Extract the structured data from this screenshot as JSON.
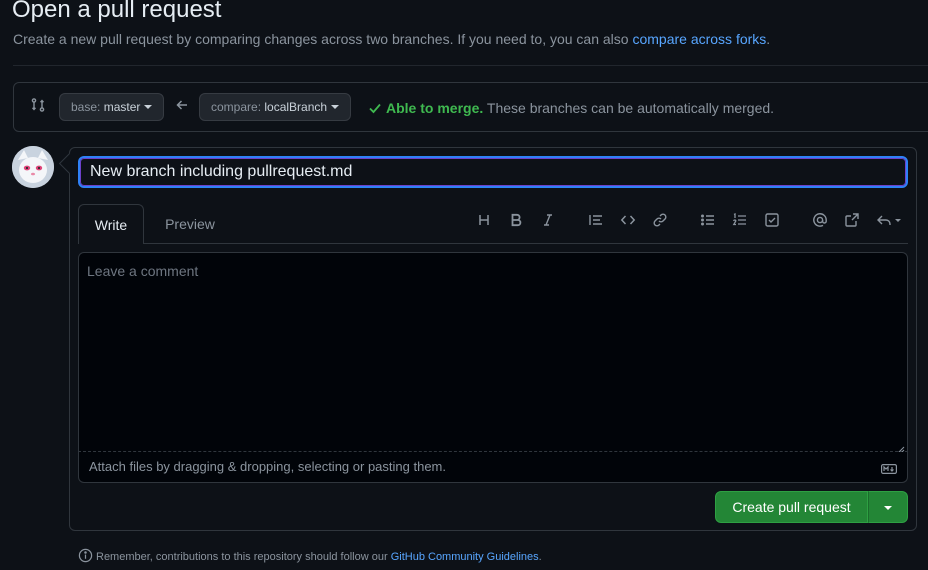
{
  "header": {
    "title": "Open a pull request",
    "subtitle_prefix": "Create a new pull request by comparing changes across two branches. If you need to, you can also ",
    "subtitle_link": "compare across forks",
    "subtitle_suffix": "."
  },
  "compare": {
    "base_label": "base:",
    "base_branch": "master",
    "compare_label": "compare:",
    "compare_branch": "localBranch",
    "merge_ok": "Able to merge.",
    "merge_text": "These branches can be automatically merged."
  },
  "form": {
    "title_value": "New branch including pullrequest.md",
    "tabs": [
      {
        "label": "Write",
        "active": true
      },
      {
        "label": "Preview",
        "active": false
      }
    ],
    "toolbar": [
      "heading-icon",
      "bold-icon",
      "italic-icon",
      "quote-icon",
      "code-icon",
      "link-icon",
      "unordered-list-icon",
      "ordered-list-icon",
      "task-list-icon",
      "mention-icon",
      "reference-icon",
      "reply-icon"
    ],
    "comment_placeholder": "Leave a comment",
    "attach_text": "Attach files by dragging & dropping, selecting or pasting them.",
    "submit_label": "Create pull request"
  },
  "footer": {
    "prefix": "Remember, contributions to this repository should follow our ",
    "link": "GitHub Community Guidelines",
    "suffix": "."
  },
  "colors": {
    "background": "#0d1117",
    "accent_link": "#58a6ff",
    "success": "#3fb950",
    "primary_button": "#238636"
  }
}
